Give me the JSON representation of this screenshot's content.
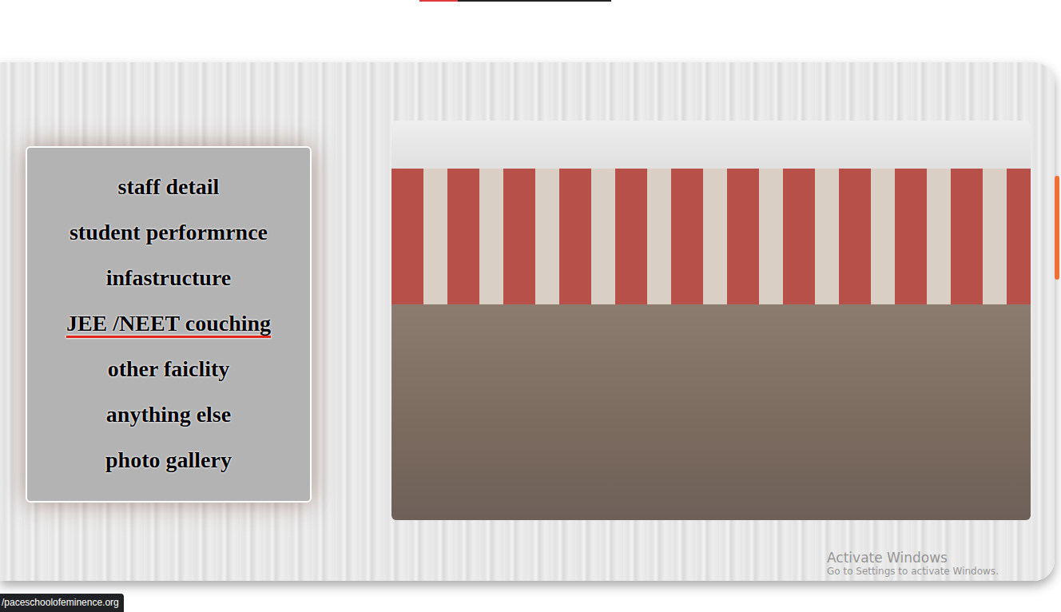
{
  "menu": {
    "items": [
      {
        "label": "staff detail",
        "selected": false
      },
      {
        "label": "student performrnce",
        "selected": false
      },
      {
        "label": "infastructure",
        "selected": false
      },
      {
        "label": "JEE /NEET couching",
        "selected": true
      },
      {
        "label": "other faiclity",
        "selected": false
      },
      {
        "label": "anything else",
        "selected": false
      },
      {
        "label": "photo gallery",
        "selected": false
      }
    ]
  },
  "status_bar": {
    "url": "/paceschoolofeminence.org"
  },
  "watermark": {
    "title": "Activate Windows",
    "subtitle": "Go to Settings to activate Windows."
  }
}
